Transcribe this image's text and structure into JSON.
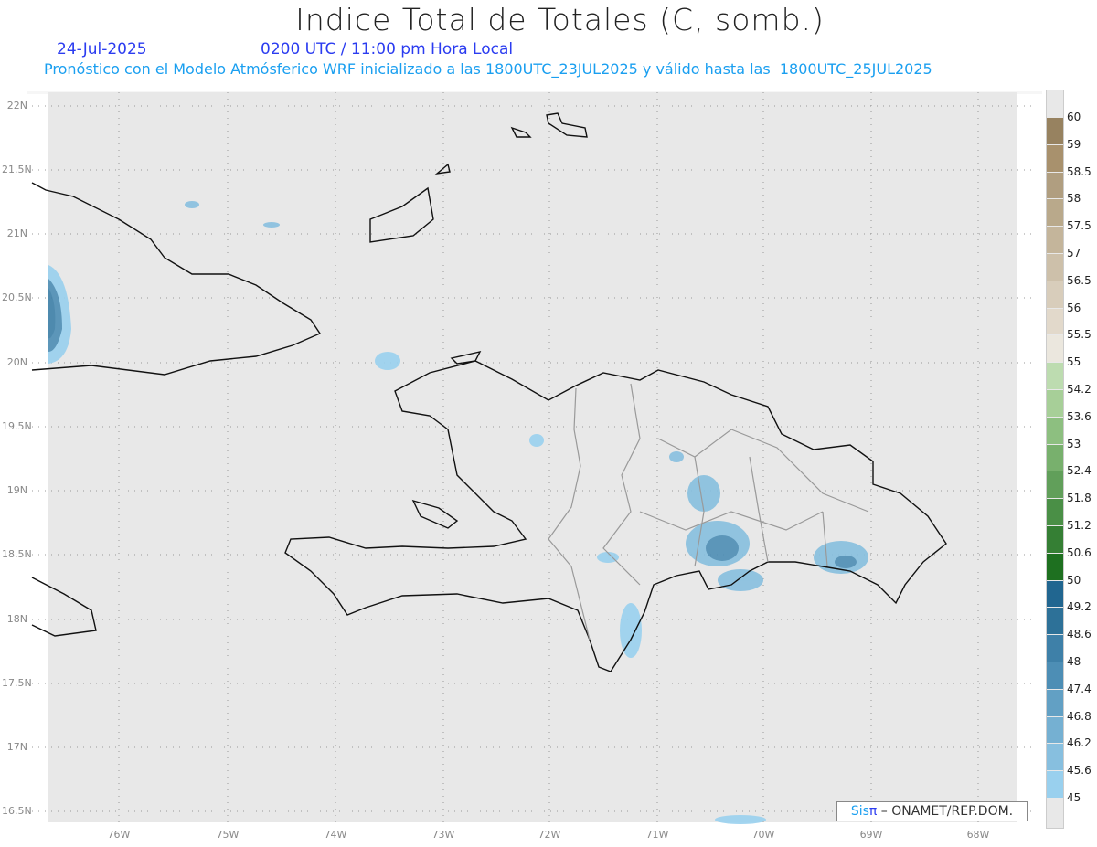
{
  "title": "Indice Total de Totales (C, somb.)",
  "date": "24-Jul-2025",
  "time": "0200 UTC / 11:00 pm Hora Local",
  "subtitle": "Pronóstico con el Modelo Atmósferico WRF inicializado a las 1800UTC_23JUL2025 y válido hasta las  1800UTC_25JUL2025",
  "lat_labels": [
    "22N",
    "21.5N",
    "21N",
    "20.5N",
    "20N",
    "19.5N",
    "19N",
    "18.5N",
    "18N",
    "17.5N",
    "17N",
    "16.5N"
  ],
  "lon_labels": [
    "76W",
    "75W",
    "74W",
    "73W",
    "72W",
    "71W",
    "70W",
    "69W",
    "68W"
  ],
  "legend": {
    "levels": [
      "60",
      "59",
      "58.5",
      "58",
      "57.5",
      "57",
      "56.5",
      "56",
      "55.5",
      "55",
      "54.2",
      "53.6",
      "53",
      "52.4",
      "51.8",
      "51.2",
      "50.6",
      "50",
      "49.2",
      "48.6",
      "48",
      "47.4",
      "46.8",
      "46.2",
      "45.6",
      "45"
    ],
    "colors": [
      "#978260",
      "#a8916d",
      "#b09e80",
      "#b9a98b",
      "#c4b59b",
      "#cdc0aa",
      "#d8cdbb",
      "#e2d9cb",
      "#ebe7de",
      "#bddcb0",
      "#a7cf98",
      "#8dbf80",
      "#78b06d",
      "#619f5a",
      "#4a8f46",
      "#357f34",
      "#1e7020",
      "#216690",
      "#2d7198",
      "#3e80a8",
      "#4d8eb5",
      "#62a0c4",
      "#75b0d2",
      "#87bfdf",
      "#99d0ee"
    ]
  },
  "credit": {
    "sis": "Sis",
    "pi": "π",
    "rest": " –  ONAMET/REP.DOM."
  }
}
